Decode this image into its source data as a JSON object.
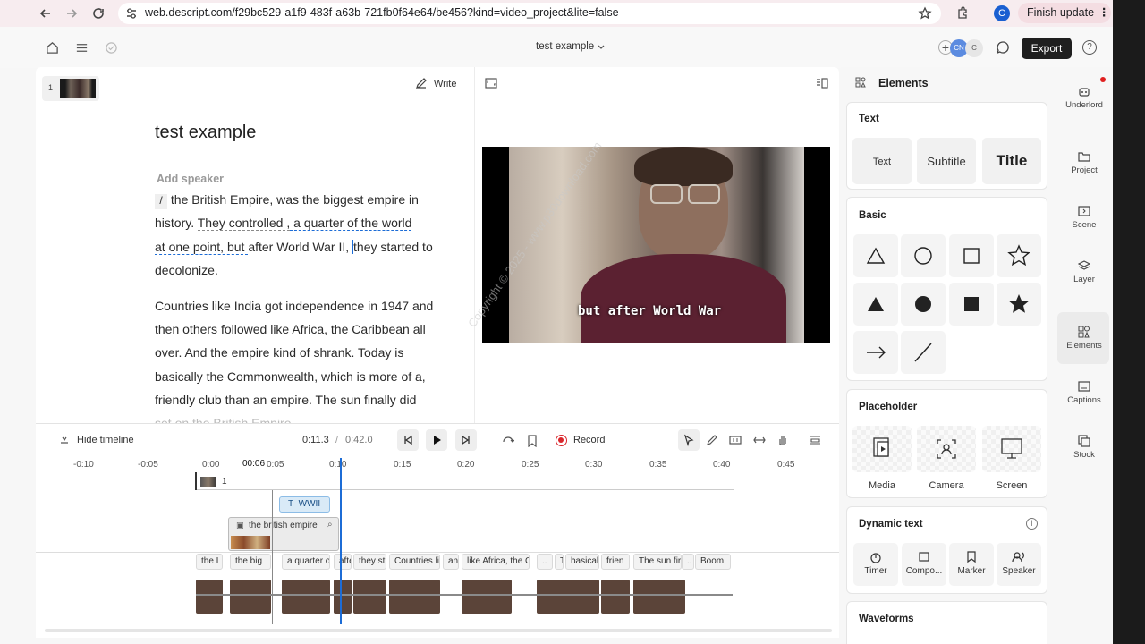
{
  "browser": {
    "url": "web.descript.com/f29bc529-a1f9-483f-a63b-721fb0f64e64/be456?kind=video_project&lite=false",
    "profile_initial": "C",
    "finish_update_label": "Finish update"
  },
  "topbar": {
    "doc_title": "test example",
    "collab_initials": [
      "CN",
      "C"
    ],
    "export_label": "Export"
  },
  "editor": {
    "scene_number": "1",
    "write_label": "Write",
    "script_title": "test example",
    "add_speaker": "Add speaker",
    "para1": {
      "slash": "/",
      "l1a": " the British Empire, ",
      "l1b": "was ",
      "l1c": "the biggest empire in",
      "l2a": "history.  ",
      "l2b": "They controlled ,",
      "l2c": " a quarter of the world",
      "l3a": "at one point, but ",
      "l3b": "after World War II, ",
      "l3c": "they started to",
      "l4": "decolonize."
    },
    "para2": {
      "l1": "Countries like India got independence in 1947 and",
      "l2a": "then others followed ",
      "l2b": "like Africa, the Caribbean all",
      "l3a": "over. And the empire kind of  ",
      "l3b": "shrank. ",
      "l3c": "Today is",
      "l4": "basically the Commonwealth, which is more of a,",
      "l5a": "friendly club than an empire. ",
      "l5b": "The sun finally did",
      "l6": "set on the British Empire."
    },
    "caption": "but after World War",
    "watermark": "Copyright © 2025 - www.p30download.com"
  },
  "timeline": {
    "hide_label": "Hide timeline",
    "current_time": "0:11.3",
    "separator": "/",
    "total_time": "0:42.0",
    "record_label": "Record",
    "playhead_label": "00:06",
    "ticks": [
      "-0:10",
      "-0:05",
      "0:00",
      "0:05",
      "0:10",
      "0:15",
      "0:20",
      "0:25",
      "0:30",
      "0:35",
      "0:40",
      "0:45"
    ],
    "scene_label": "1",
    "text_clip": "WWII",
    "image_clip": "the british empire",
    "word_chips": [
      "the I",
      "the big",
      "a quarter o",
      "afte",
      "they st",
      "Countries li",
      "an",
      "like Africa, the C",
      "..",
      "T",
      "basical",
      "frien",
      "The sun fir",
      "..",
      "Boom"
    ]
  },
  "elements_panel": {
    "title": "Elements",
    "text_section": "Text",
    "text_tiles": [
      "Text",
      "Subtitle",
      "Title"
    ],
    "basic_section": "Basic",
    "placeholder_section": "Placeholder",
    "placeholders": [
      "Media",
      "Camera",
      "Screen"
    ],
    "dynamic_section": "Dynamic text",
    "dynamic_items": [
      "Timer",
      "Compo...",
      "Marker",
      "Speaker"
    ],
    "waveforms_section": "Waveforms"
  },
  "rail": {
    "items": [
      "Underlord",
      "Project",
      "Scene",
      "Layer",
      "Elements",
      "Captions",
      "Stock"
    ]
  },
  "colors": {
    "accent_blue": "#1c6cd6",
    "record_red": "#d9262c",
    "export_bg": "#1f1f1f",
    "text_clip_bg": "#d9eaf7"
  }
}
